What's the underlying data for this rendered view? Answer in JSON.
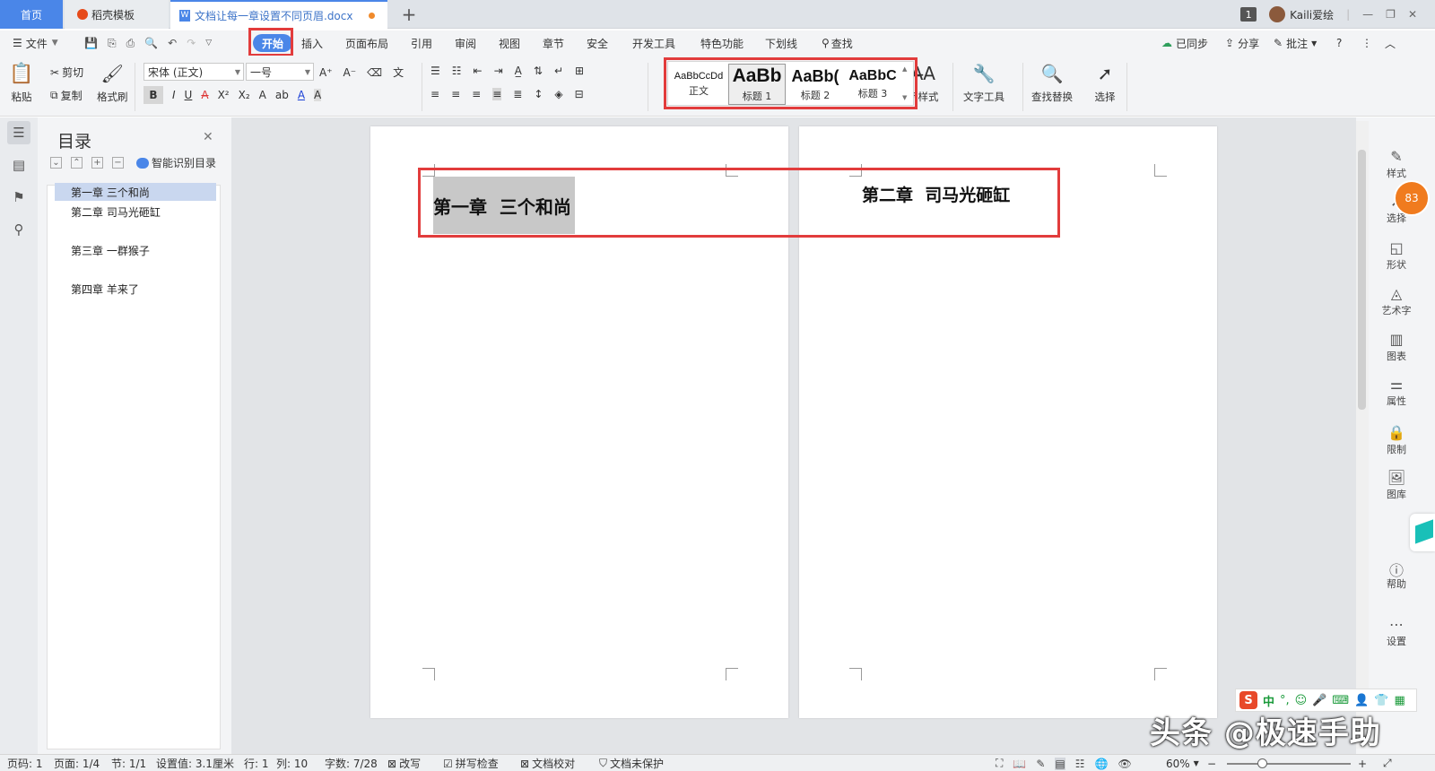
{
  "tabs": {
    "home": "首页",
    "template": "稻壳模板",
    "document": "文档让每一章设置不同页眉.docx",
    "add": "+"
  },
  "titlebar": {
    "badge": "1",
    "user": "Kaili爱绘"
  },
  "menu": {
    "file": "文件",
    "items": [
      "开始",
      "插入",
      "页面布局",
      "引用",
      "审阅",
      "视图",
      "章节",
      "安全",
      "开发工具",
      "特色功能",
      "下划线",
      "查找"
    ],
    "sync": "已同步",
    "share": "分享",
    "comment": "批注",
    "help": "?"
  },
  "ribbon": {
    "paste": "粘贴",
    "cut": "剪切",
    "copy": "复制",
    "format_painter": "格式刷",
    "font_name": "宋体 (正文)",
    "font_size": "一号",
    "styles": [
      {
        "preview": "AaBbCcDd",
        "name": "正文"
      },
      {
        "preview": "AaBb",
        "name": "标题 1"
      },
      {
        "preview": "AaBb(",
        "name": "标题 2"
      },
      {
        "preview": "AaBbC",
        "name": "标题 3"
      }
    ],
    "new_style": "新样式",
    "text_tools": "文字工具",
    "find_replace": "查找替换",
    "select": "选择"
  },
  "toc": {
    "title": "目录",
    "smart": "智能识别目录",
    "items": [
      "第一章 三个和尚",
      "第二章 司马光砸缸",
      "第三章 一群猴子",
      "第四章 羊来了"
    ]
  },
  "document": {
    "page1_heading": "第一章  三个和尚",
    "page2_heading": "第二章  司马光砸缸"
  },
  "right_panel": {
    "items": [
      "样式",
      "选择",
      "形状",
      "艺术字",
      "图表",
      "属性",
      "限制",
      "图库",
      "帮助",
      "设置"
    ],
    "notification_count": "83"
  },
  "status": {
    "page": "页码: 1",
    "pages": "页面: 1/4",
    "section": "节: 1/1",
    "setting": "设置值: 3.1厘米",
    "row": "行: 1",
    "col": "列: 10",
    "words": "字数: 7/28",
    "revise": "改写",
    "spell": "拼写检查",
    "proof": "文档校对",
    "protect": "文档未保护",
    "zoom": "60%"
  },
  "ime": {
    "label": "中"
  },
  "watermark": "头条 @极速手助",
  "colors": {
    "accent": "#4a86e8",
    "highlight_box": "#e23c3c",
    "toc_selected": "#c9d7ef"
  }
}
